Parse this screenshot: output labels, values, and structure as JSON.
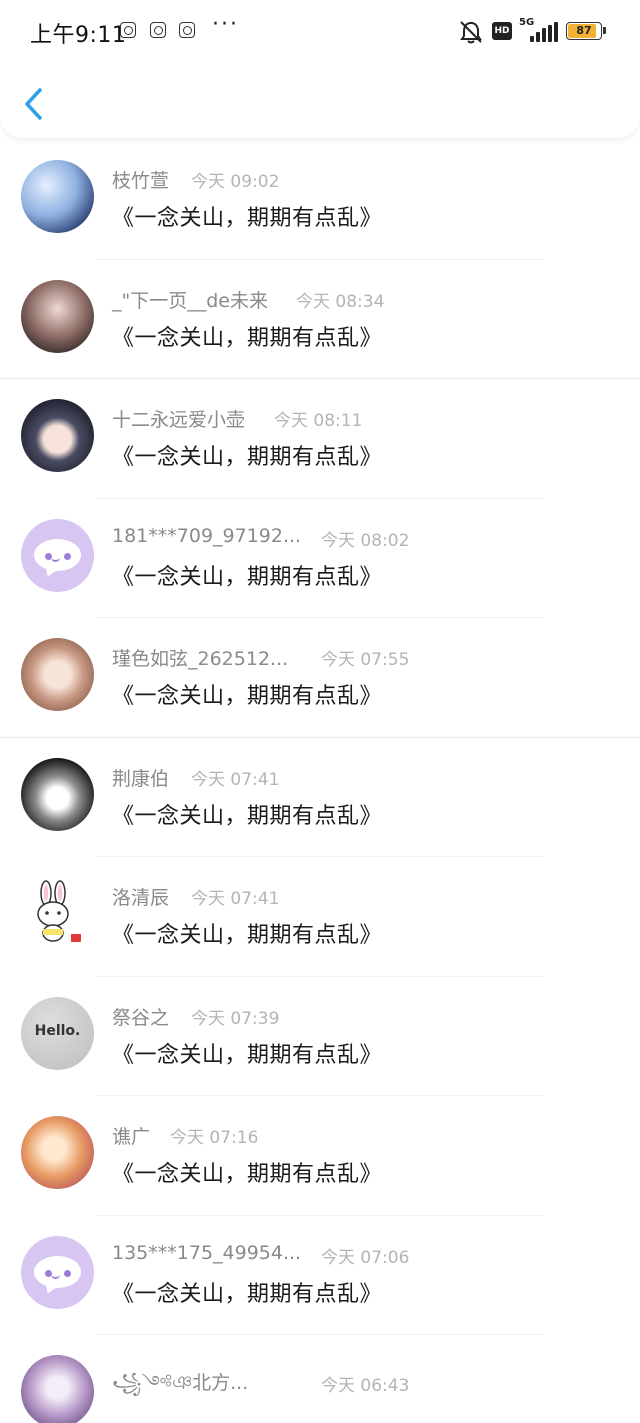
{
  "status_bar": {
    "time": "上午9:11",
    "more": "···",
    "hd": "HD",
    "network": "5G",
    "battery": "87",
    "battery_level": 0.87,
    "icons": [
      "notification-icon",
      "notification-icon",
      "notification-icon",
      "silent-bell-icon",
      "hd-icon",
      "signal-icon",
      "battery-icon"
    ]
  },
  "header": {
    "back_icon": "chevron-left-icon",
    "accent": "#2f9fe8"
  },
  "messages": [
    {
      "name": "枝竹萱",
      "time": "今天 09:02",
      "text": "《一念关山，期期有点乱》",
      "avatar": "photo"
    },
    {
      "name": "_\"下一页__de未来",
      "time": "今天 08:34",
      "text": "《一念关山，期期有点乱》",
      "avatar": "photo"
    },
    {
      "name": "十二永远爱小壶",
      "time": "今天 08:11",
      "text": "《一念关山，期期有点乱》",
      "avatar": "photo"
    },
    {
      "name": "181***709_97192...",
      "time": "今天 08:02",
      "text": "《一念关山，期期有点乱》",
      "avatar": "default-chat"
    },
    {
      "name": "瑾色如弦_262512...",
      "time": "今天 07:55",
      "text": "《一念关山，期期有点乱》",
      "avatar": "photo"
    },
    {
      "name": "荆康伯",
      "time": "今天 07:41",
      "text": "《一念关山，期期有点乱》",
      "avatar": "photo"
    },
    {
      "name": "洛清辰",
      "time": "今天 07:41",
      "text": "《一念关山，期期有点乱》",
      "avatar": "rabbit"
    },
    {
      "name": "祭谷之",
      "time": "今天 07:39",
      "text": "《一念关山，期期有点乱》",
      "avatar": "hello",
      "avatar_text": "Hello."
    },
    {
      "name": "谯广",
      "time": "今天 07:16",
      "text": "《一念关山，期期有点乱》",
      "avatar": "photo"
    },
    {
      "name": "135***175_49954...",
      "time": "今天 07:06",
      "text": "《一念关山，期期有点乱》",
      "avatar": "default-chat"
    },
    {
      "name": "꧁༺ঞ北方...",
      "time": "今天 06:43",
      "text": "",
      "avatar": "photo"
    }
  ],
  "colors": {
    "name": "#8a8a8a",
    "time": "#b4b4b4",
    "message": "#1b1b1b",
    "chat_avatar_bg": "#d7c6f2",
    "battery": "#f2b233"
  }
}
